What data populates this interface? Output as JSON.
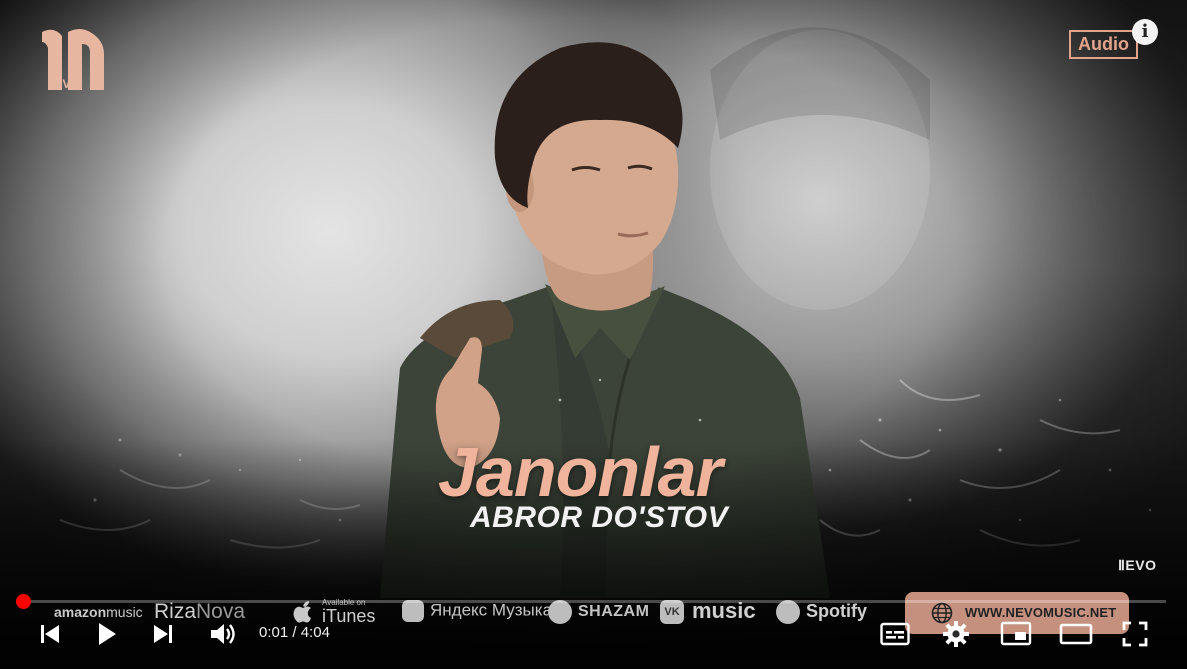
{
  "channel_logo": {
    "tv_label": "TV"
  },
  "badge": {
    "audio": "Audio"
  },
  "info_button": {
    "label": "i"
  },
  "video": {
    "song_title": "Janonlar",
    "artist": "ABROR DO'STOV",
    "nevo_logo": "ⅡEVO"
  },
  "stores": {
    "amazon_a": "amazon",
    "amazon_b": "music",
    "riza_a": "Riza",
    "riza_b": "Nova",
    "itunes_small": "Available on",
    "itunes_big": "iTunes",
    "yandex": "Яндекс Музыка",
    "shazam": "SHAZAM",
    "vk_icon": "VK",
    "vk": "music",
    "spotify": "Spotify",
    "website": "WWW.NEVOMUSIC.NET"
  },
  "player": {
    "progress_fraction": 0.004,
    "current_time": "0:01",
    "separator": " / ",
    "duration": "4:04",
    "time_display": "0:01 / 4:04",
    "accent_color": "#ff0000"
  },
  "icons": [
    "skip-previous-icon",
    "play-icon",
    "skip-next-icon",
    "volume-icon",
    "subtitles-icon",
    "settings-gear-icon",
    "miniplayer-icon",
    "theater-mode-icon",
    "fullscreen-icon"
  ]
}
